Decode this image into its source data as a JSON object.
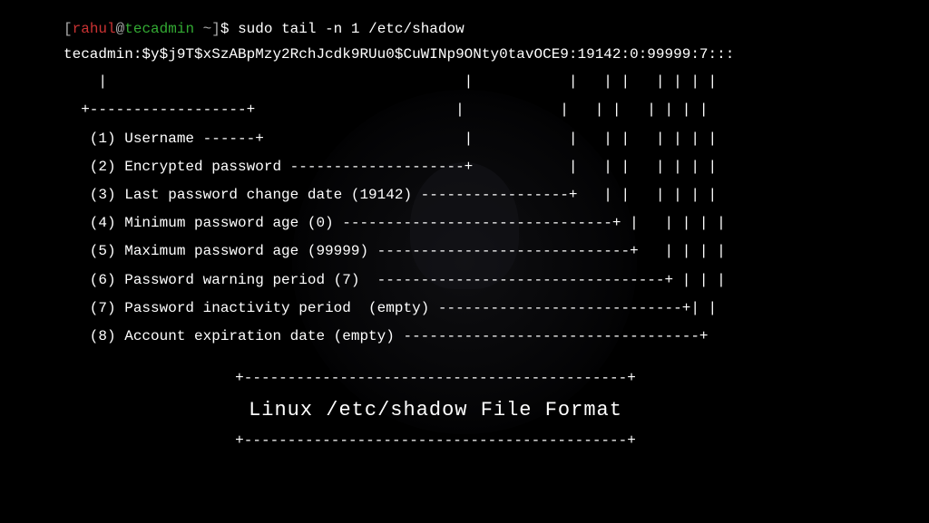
{
  "prompt": {
    "open_bracket": "[",
    "user": "rahul",
    "at": "@",
    "host": "tecadmin",
    "tilde": " ~",
    "close_bracket": "]",
    "dollar": "$ ",
    "command": "sudo tail -n 1 /etc/shadow"
  },
  "output": "tecadmin:$y$j9T$xSzABpMzy2RchJcdk9RUu0$CuWINp9ONty0tavOCE9:19142:0:99999:7:::",
  "diagram": "    |                                         |           |   | |   | | | |\n  +------------------+                       |           |   | |   | | | |\n   (1) Username ------+                       |           |   | |   | | | |\n   (2) Encrypted password --------------------+           |   | |   | | | |\n   (3) Last password change date (19142) -----------------+   | |   | | | |\n   (4) Minimum password age (0) -------------------------------+ |   | | | |\n   (5) Maximum password age (99999) -----------------------------+   | | | |\n   (6) Password warning period (7)  ---------------------------------+ | | |\n   (7) Password inactivity period  (empty) ----------------------------+| |\n   (8) Account expiration date (empty) ----------------------------------+",
  "title": {
    "top_line": "+--------------------------------------------+",
    "text": "Linux /etc/shadow File Format",
    "bottom_line": "+--------------------------------------------+"
  },
  "shadow_fields": [
    {
      "index": 1,
      "name": "Username",
      "value": "tecadmin"
    },
    {
      "index": 2,
      "name": "Encrypted password",
      "value": "$y$j9T$xSzABpMzy2RchJcdk9RUu0$CuWINp9ONty0tavOCE9"
    },
    {
      "index": 3,
      "name": "Last password change date",
      "value": "19142"
    },
    {
      "index": 4,
      "name": "Minimum password age",
      "value": "0"
    },
    {
      "index": 5,
      "name": "Maximum password age",
      "value": "99999"
    },
    {
      "index": 6,
      "name": "Password warning period",
      "value": "7"
    },
    {
      "index": 7,
      "name": "Password inactivity period",
      "value": "empty"
    },
    {
      "index": 8,
      "name": "Account expiration date",
      "value": "empty"
    }
  ]
}
